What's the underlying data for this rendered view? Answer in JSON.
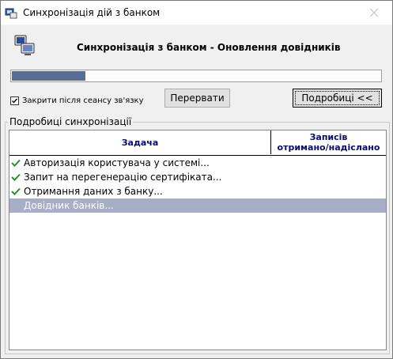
{
  "window": {
    "title": "Синхронізація дій з банком"
  },
  "header": {
    "title": "Синхронізація з банком - Оновлення довідників"
  },
  "progress": {
    "fraction": 0.2
  },
  "options": {
    "close_after_session_label": "Закрити після сеансу зв'язку",
    "close_after_session_checked": true
  },
  "buttons": {
    "interrupt_label": "Перервати",
    "details_label": "Подробиці <<"
  },
  "details": {
    "group_label": "Подробиці синхронізації",
    "columns": {
      "task": "Задача",
      "records_line1": "Записів",
      "records_line2": "отримано/надіслано"
    },
    "rows": [
      {
        "task": "Авторизація користувача у системі...",
        "status": "done"
      },
      {
        "task": "Запит на перегенерацію сертифіката...",
        "status": "done"
      },
      {
        "task": "Отримання даних з банку...",
        "status": "done"
      },
      {
        "task": "Довідник банків...",
        "status": "in-progress"
      }
    ]
  },
  "colors": {
    "progress": "#5a6b98",
    "selected_row": "#a7aec6",
    "check": "#2e8b2e",
    "header_text": "#0a0a6e"
  }
}
